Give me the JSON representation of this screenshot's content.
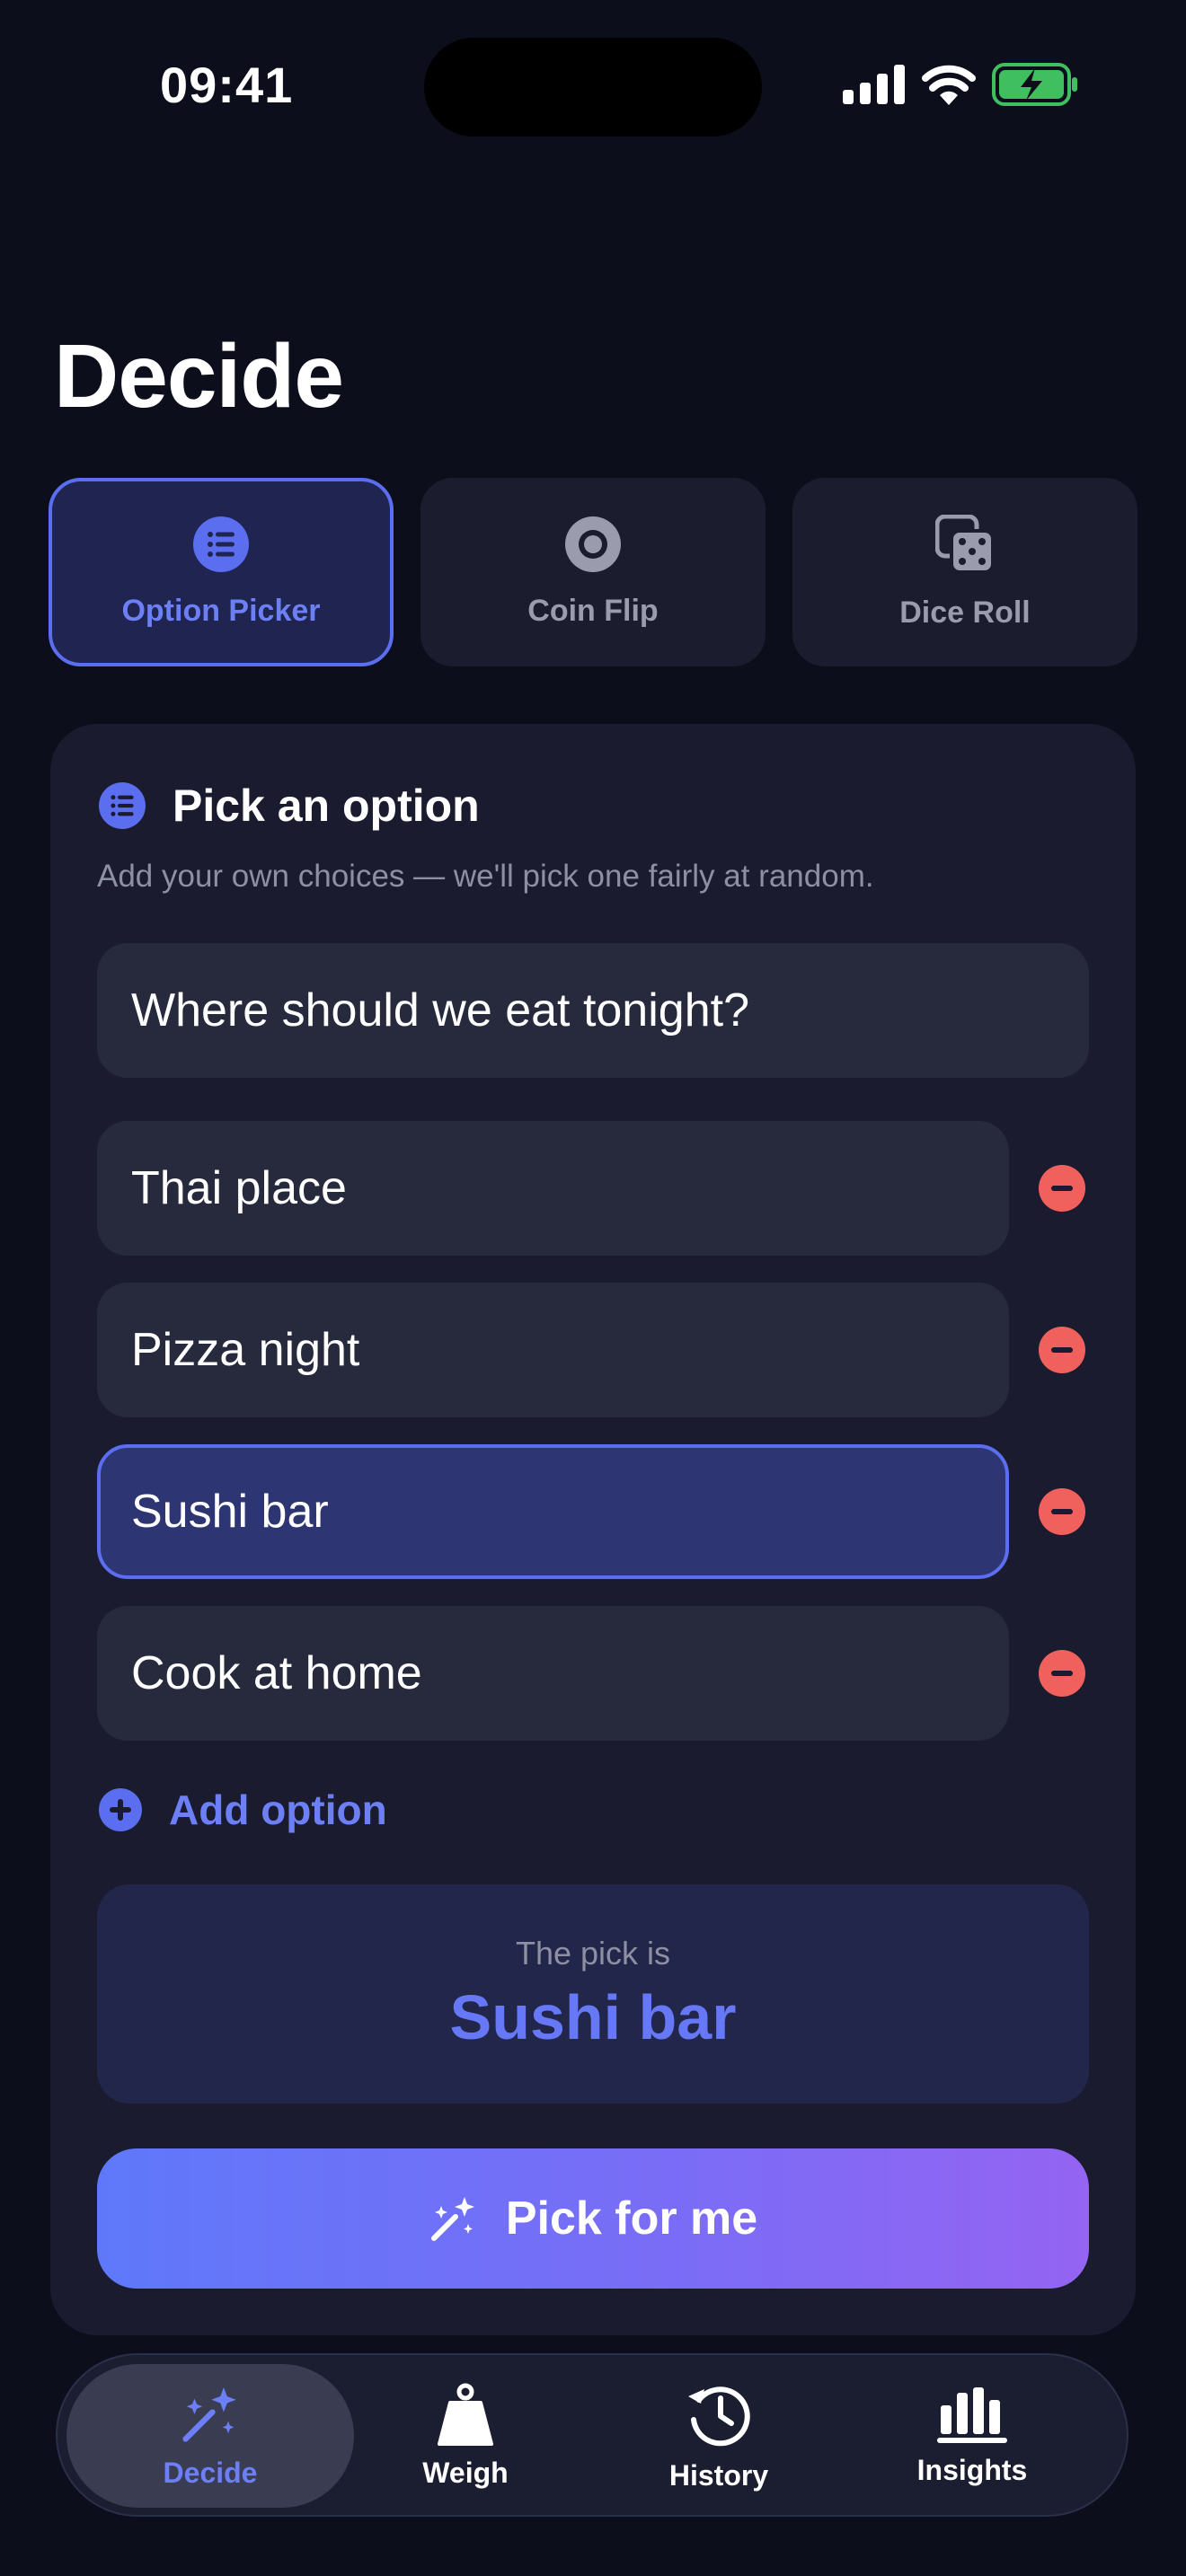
{
  "status_bar": {
    "time": "09:41"
  },
  "page": {
    "title": "Decide"
  },
  "modes": [
    {
      "label": "Option Picker",
      "icon": "list-icon",
      "active": true
    },
    {
      "label": "Coin Flip",
      "icon": "coin-icon",
      "active": false
    },
    {
      "label": "Dice Roll",
      "icon": "dice-icon",
      "active": false
    }
  ],
  "card": {
    "title": "Pick an option",
    "subtitle": "Add your own choices — we'll pick one fairly at random.",
    "question": "Where should we eat tonight?",
    "options": [
      "Thai place",
      "Pizza night",
      "Sushi bar",
      "Cook at home"
    ],
    "selected_option": "Sushi bar",
    "add_label": "Add option",
    "result_caption": "The pick is",
    "result_value": "Sushi bar",
    "pick_button": "Pick for me"
  },
  "tabbar": [
    {
      "label": "Decide",
      "icon": "magic-wand-icon",
      "active": true
    },
    {
      "label": "Weigh",
      "icon": "weight-icon",
      "active": false
    },
    {
      "label": "History",
      "icon": "history-icon",
      "active": false
    },
    {
      "label": "Insights",
      "icon": "bar-chart-icon",
      "active": false
    }
  ],
  "colors": {
    "accent": "#5b6ef0",
    "danger": "#f0615d",
    "background": "#0c0e1b",
    "card": "#1a1b2e"
  }
}
